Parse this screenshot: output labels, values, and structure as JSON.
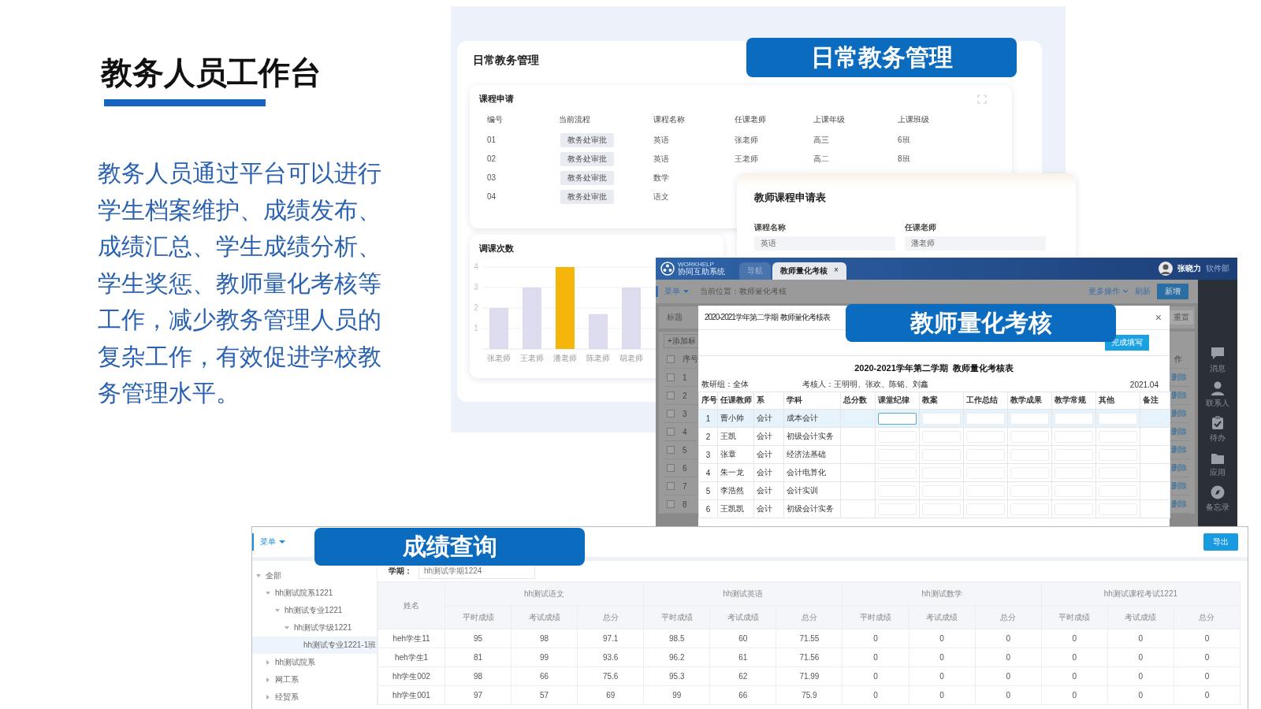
{
  "intro": {
    "title": "教务人员工作台",
    "body": "教务人员通过平台可以进行学生档案维护、成绩发布、成绩汇总、学生成绩分析、学生奖惩、教师量化考核等工作，减少教务管理人员的复杂工作，有效促进学校教务管理水平。"
  },
  "daily": {
    "badge": "日常教务管理",
    "title": "日常教务管理",
    "course_requests": {
      "title": "课程申请",
      "columns": [
        "编号",
        "当前流程",
        "课程名称",
        "任课老师",
        "上课年级",
        "上课班级"
      ],
      "rows": [
        [
          "01",
          "教务处审批",
          "英语",
          "张老师",
          "高三",
          "6班"
        ],
        [
          "02",
          "教务处审批",
          "英语",
          "王老师",
          "高二",
          "8班"
        ],
        [
          "03",
          "教务处审批",
          "数学"
        ],
        [
          "04",
          "教务处审批",
          "语文"
        ]
      ]
    },
    "reschedule": {
      "title": "调课次数",
      "chart_data": {
        "type": "bar",
        "categories": [
          "张老师",
          "王老师",
          "潘老师",
          "陈老师",
          "胡老师"
        ],
        "stacked": true,
        "grid": true,
        "ylim": [
          0,
          4
        ],
        "yticks": [
          1,
          2,
          3,
          4
        ],
        "series": [
          {
            "color": "#dcdcee",
            "values": [
              2,
              3,
              null,
              1.7,
              3
            ]
          },
          {
            "color": "#f5b50a",
            "values": [
              null,
              null,
              4,
              null,
              null
            ]
          }
        ]
      }
    },
    "application_form": {
      "title": "教师课程申请表",
      "fields": [
        {
          "label": "课程名称",
          "value": "英语"
        },
        {
          "label": "任课老师",
          "value": "潘老师"
        }
      ]
    }
  },
  "assessment": {
    "badge": "教师量化考核",
    "app": {
      "caption": "WORKHELP",
      "name": "协同互助系统"
    },
    "tabs": [
      {
        "label": "导航",
        "selected": false
      },
      {
        "label": "教师量化考核",
        "selected": true
      }
    ],
    "tab_close": "×",
    "user": {
      "name": "张晓力",
      "department": "软件部"
    },
    "menu": "菜单",
    "breadcrumb": "当前位置：教师量化考核",
    "more": "更多操作",
    "refresh": "刷新",
    "create": "新增",
    "filter_label": "标题",
    "reset": "重置",
    "add": "+添加标",
    "list_header": "序号",
    "header_checked": false,
    "action_header": "作",
    "list_rows": [
      {
        "number": "1",
        "action": "删除",
        "checked": false
      },
      {
        "number": "2",
        "action": "删除",
        "checked": false
      },
      {
        "number": "3",
        "action": "删除",
        "checked": false
      },
      {
        "number": "4",
        "action": "删除",
        "checked": false
      },
      {
        "number": "5",
        "action": "删除",
        "checked": false
      },
      {
        "number": "6",
        "action": "删除",
        "checked": false
      },
      {
        "number": "7",
        "action": "删除",
        "checked": false
      },
      {
        "number": "8",
        "action": "删除",
        "checked": false
      }
    ],
    "side_nav": [
      {
        "label": "消息",
        "kind": "chat"
      },
      {
        "label": "联系人",
        "kind": "person"
      },
      {
        "label": "待办",
        "kind": "todo"
      },
      {
        "label": "应用",
        "kind": "folder"
      },
      {
        "label": "备忘录",
        "kind": "compass"
      }
    ],
    "modal": {
      "title": "2020-2021学年第二学期  教师量化考核表",
      "close": "×",
      "submit": "完成填写",
      "sheet_title": "2020-2021学年第二学期  教师量化考核表",
      "group": "教研组：全体",
      "assessors": "考核人：王明明、张欢、陈铭、刘鑫",
      "date": "2021.04",
      "columns": [
        "序号",
        "任课教师",
        "系",
        "学科",
        "总分数",
        "课堂纪律",
        "教案",
        "工作总结",
        "教学成果",
        "教学常规",
        "其他",
        "备注"
      ],
      "rows": [
        {
          "cells": [
            "1",
            "曹小帅",
            "会计",
            "成本会计"
          ],
          "selected": true
        },
        {
          "cells": [
            "2",
            "王凯",
            "会计",
            "初级会计实务"
          ],
          "selected": false
        },
        {
          "cells": [
            "3",
            "张章",
            "会计",
            "经济法基础"
          ],
          "selected": false
        },
        {
          "cells": [
            "4",
            "朱一龙",
            "会计",
            "会计电算化"
          ],
          "selected": false
        },
        {
          "cells": [
            "5",
            "李浩然",
            "会计",
            "会计实训"
          ],
          "selected": false
        },
        {
          "cells": [
            "6",
            "王凯凯",
            "会计",
            "初级会计实务"
          ],
          "selected": false
        }
      ]
    }
  },
  "grades": {
    "badge": "成绩查询",
    "menu": "菜单",
    "export": "导出",
    "tree": [
      {
        "label": "全部",
        "expanded": true,
        "selected": false,
        "children": [
          {
            "label": "hh测试院系1221",
            "expanded": true,
            "selected": false,
            "children": [
              {
                "label": "hh测试专业1221",
                "expanded": true,
                "selected": false,
                "children": [
                  {
                    "label": "hh测试学级1221",
                    "expanded": true,
                    "selected": false,
                    "children": [
                      {
                        "label": "hh测试专业1221-1班",
                        "selected": true
                      }
                    ]
                  }
                ]
              }
            ]
          },
          {
            "label": "hh测试院系",
            "expanded": false,
            "selected": false
          },
          {
            "label": "网工系",
            "expanded": false,
            "selected": false
          },
          {
            "label": "经贸系",
            "expanded": false,
            "selected": false
          }
        ]
      }
    ],
    "semester": {
      "label": "学期：",
      "value": "hh测试学期1224"
    },
    "table": {
      "name_header": "姓名",
      "groups": [
        {
          "title": "hh测试语文",
          "columns": [
            "平时成绩",
            "考试成绩",
            "总分"
          ]
        },
        {
          "title": "hh测试英语",
          "columns": [
            "平时成绩",
            "考试成绩",
            "总分"
          ]
        },
        {
          "title": "hh测试数学",
          "columns": [
            "平时成绩",
            "考试成绩",
            "总分"
          ]
        },
        {
          "title": "hh测试课程考试1221",
          "columns": [
            "平时成绩",
            "考试成绩",
            "总分"
          ]
        }
      ],
      "rows": [
        {
          "name": "heh学生11",
          "scores": [
            "95",
            "98",
            "97.1",
            "98.5",
            "60",
            "71.55",
            "0",
            "0",
            "0",
            "0",
            "0",
            "0"
          ]
        },
        {
          "name": "heh学生1",
          "scores": [
            "81",
            "99",
            "93.6",
            "96.2",
            "61",
            "71.56",
            "0",
            "0",
            "0",
            "0",
            "0",
            "0"
          ]
        },
        {
          "name": "hh学生002",
          "scores": [
            "98",
            "66",
            "75.6",
            "95.3",
            "62",
            "71.99",
            "0",
            "0",
            "0",
            "0",
            "0",
            "0"
          ]
        },
        {
          "name": "hh学生001",
          "scores": [
            "97",
            "57",
            "69",
            "99",
            "66",
            "75.9",
            "0",
            "0",
            "0",
            "0",
            "0",
            "0"
          ]
        }
      ]
    }
  }
}
